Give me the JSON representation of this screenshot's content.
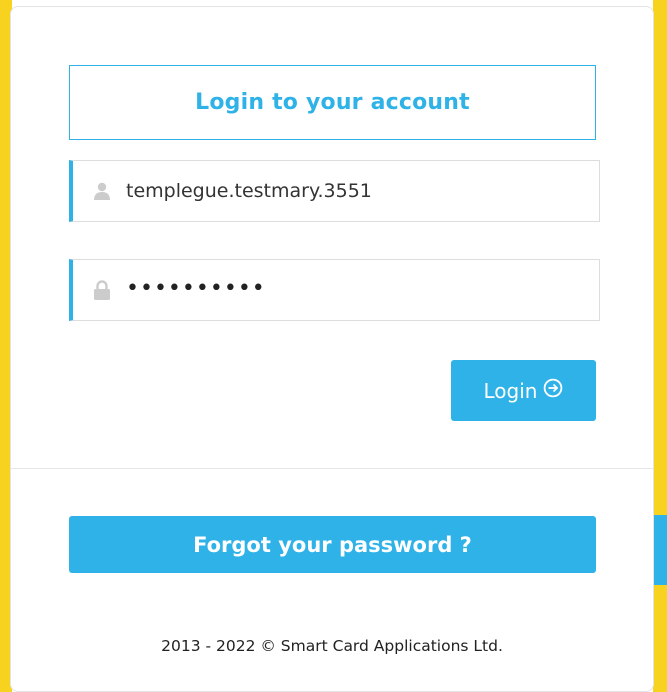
{
  "login_form": {
    "title": "Login to your account",
    "username": {
      "icon": "user-icon",
      "value": "templegue.testmary.3551"
    },
    "password": {
      "icon": "lock-icon",
      "masked_value": "••••••••••"
    },
    "login_button": {
      "label": "Login",
      "icon": "arrow-circle-right-icon"
    },
    "forgot_password_label": "Forgot your password ?"
  },
  "footer": {
    "copyright": "2013 - 2022 © Smart Card Applications Ltd."
  },
  "colors": {
    "accent": "#2eb2e7",
    "background_yellow": "#f7d21f",
    "icon_gray": "#cccccc"
  }
}
